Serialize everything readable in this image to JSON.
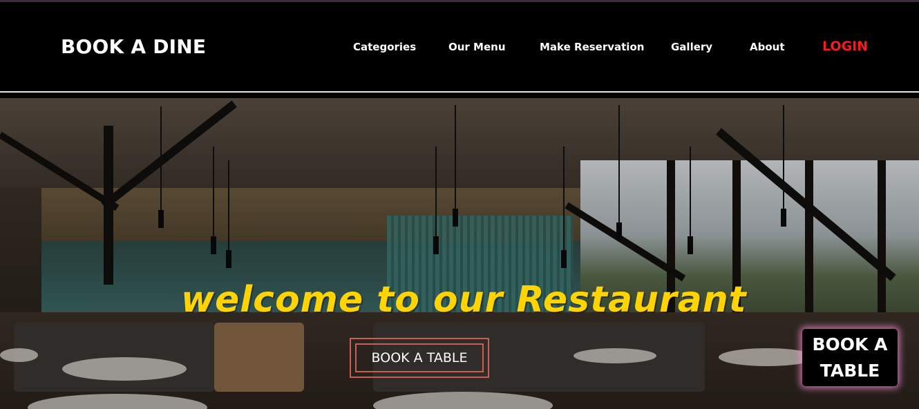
{
  "header": {
    "brand": "BOOK A DINE",
    "nav": [
      {
        "label": "Categories"
      },
      {
        "label": "Our Menu"
      },
      {
        "label": "Make Reservation"
      },
      {
        "label": "Gallery"
      },
      {
        "label": "About"
      }
    ],
    "login_label": "LOGIN"
  },
  "hero": {
    "headline": "welcome to our Restaurant",
    "cta_label": "BOOK A TABLE"
  },
  "floating_button": {
    "line1": "BOOK A",
    "line2": "TABLE"
  },
  "colors": {
    "headline": "#ffd400",
    "login": "#ff1a1a",
    "cta_border": "#c8605a",
    "float_glow": "#ff8cdc"
  }
}
